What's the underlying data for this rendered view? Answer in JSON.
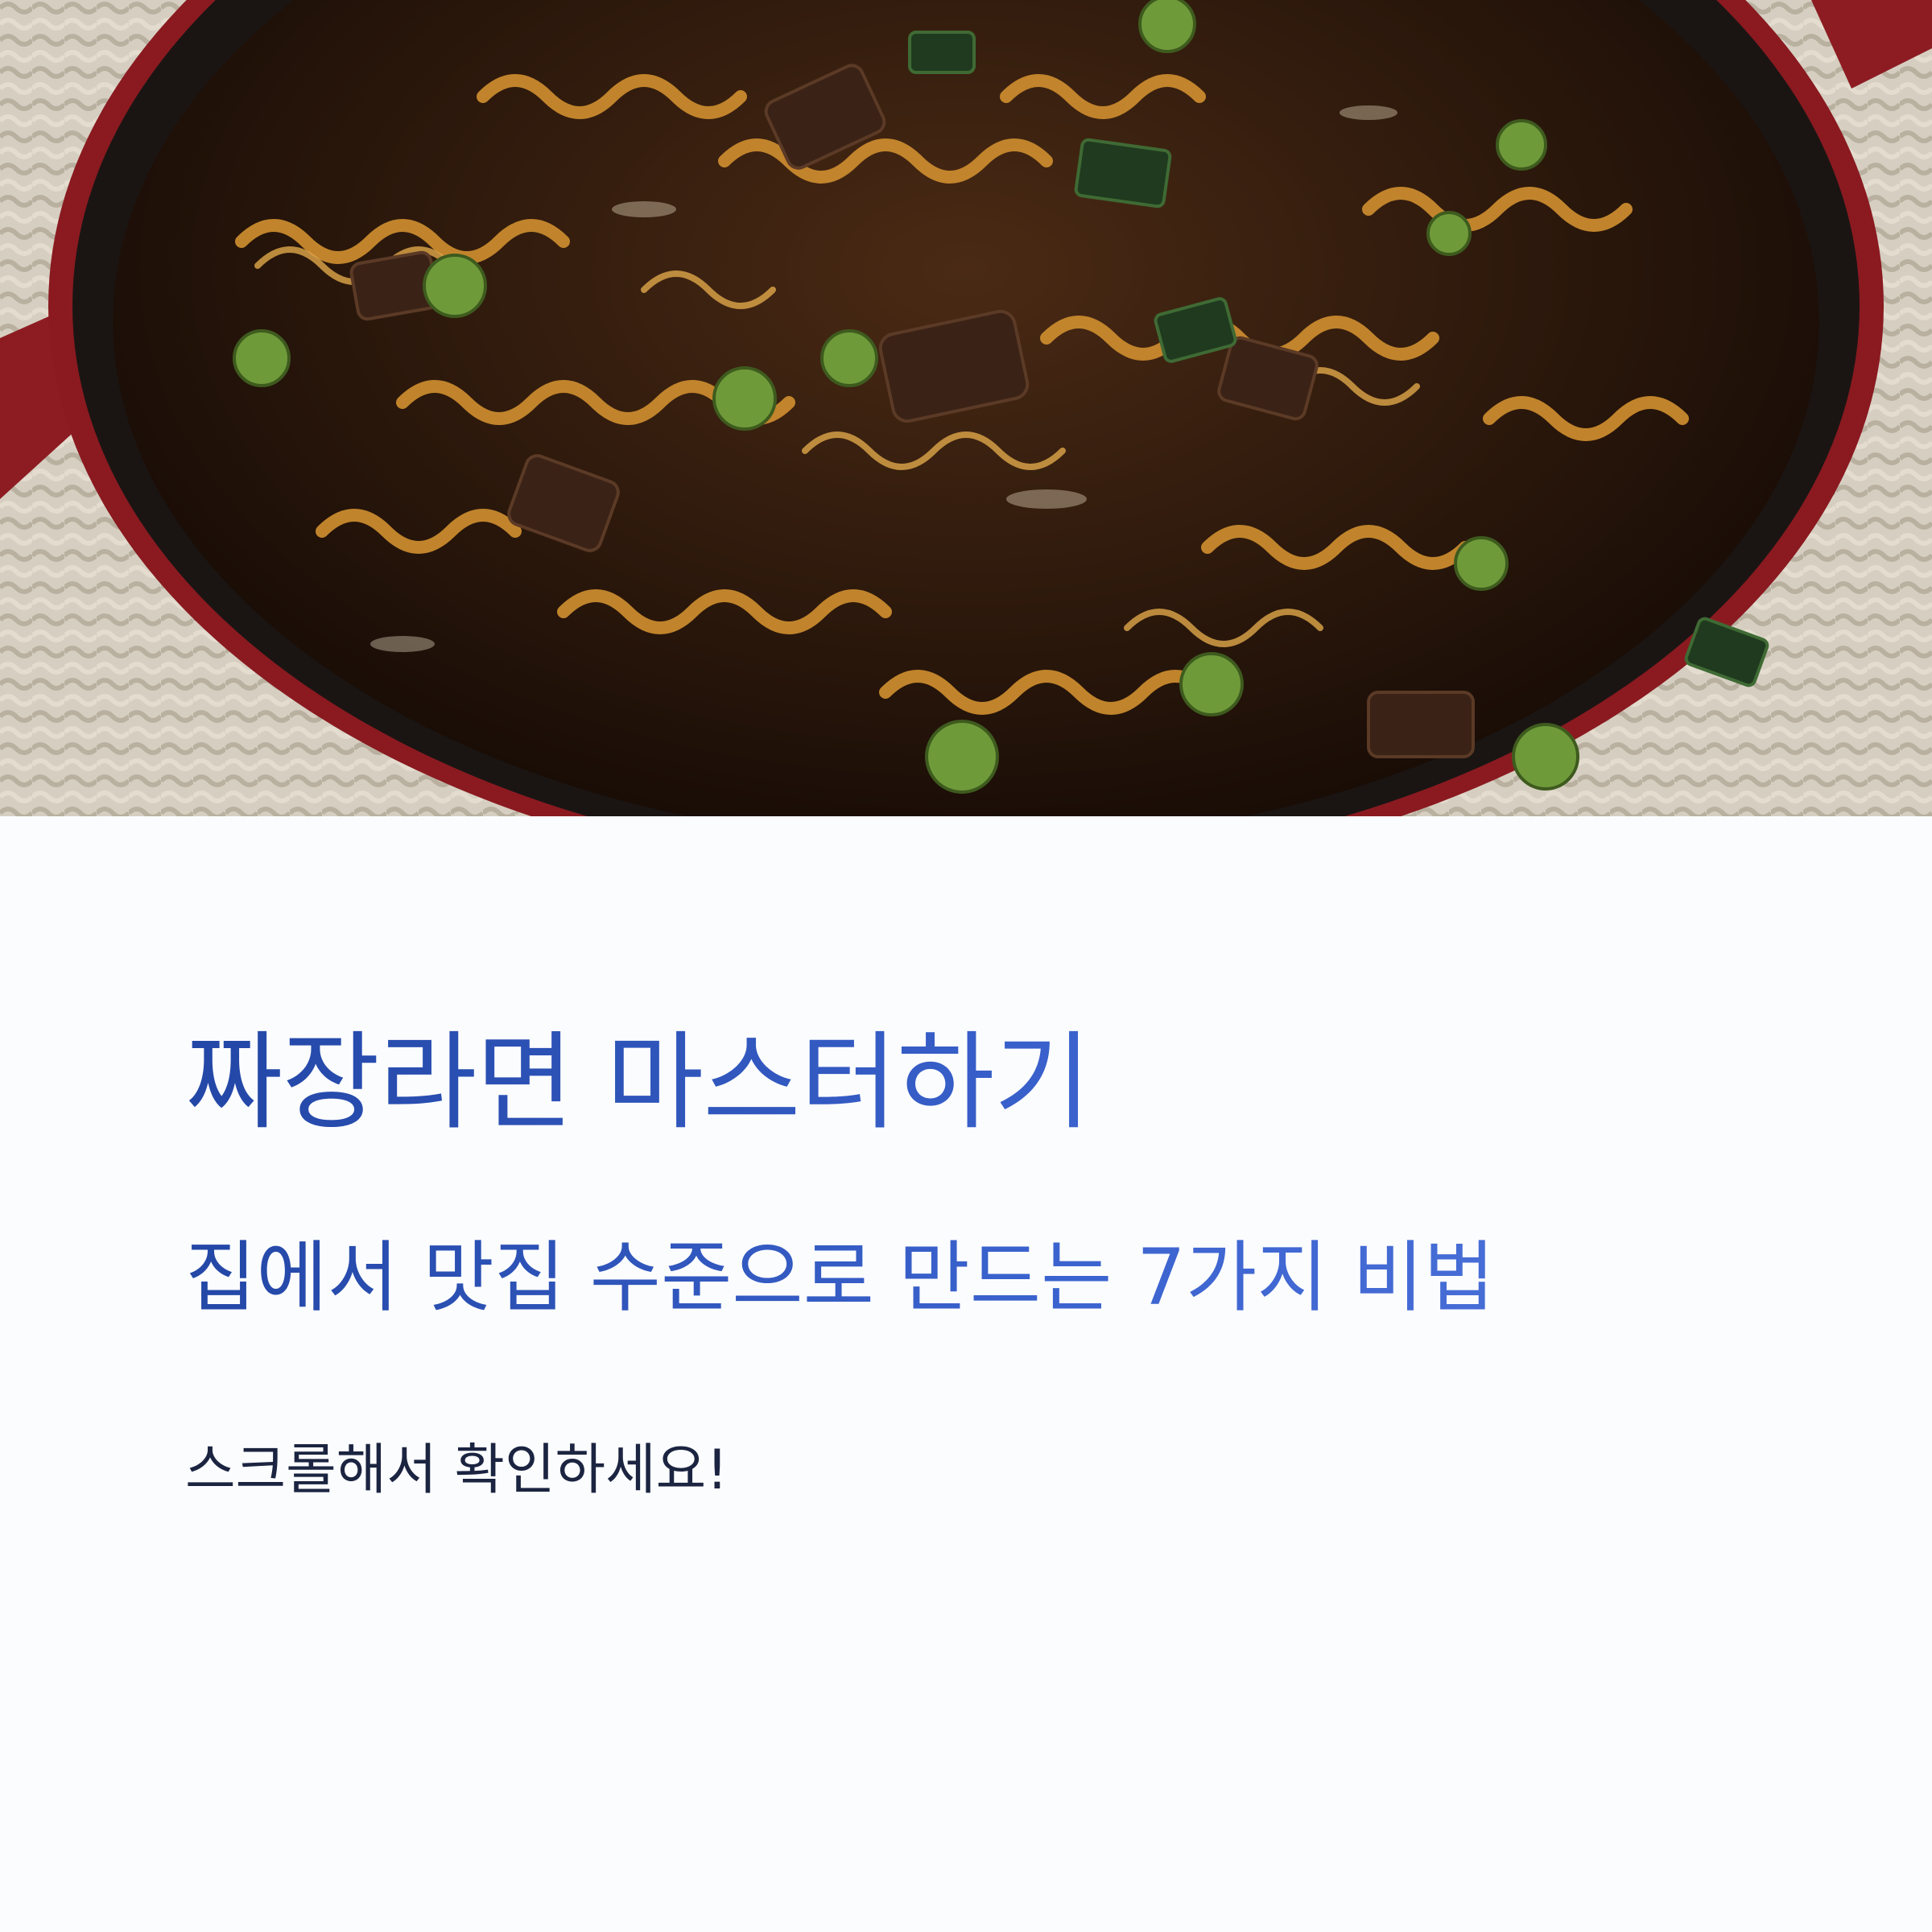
{
  "hero": {
    "photo": "jjajang-ramen-in-red-pot"
  },
  "title": "짜장라면 마스터하기",
  "subtitle": "집에서 맛집 수준으로 만드는 7가지 비법",
  "cta": "스크롤해서 확인하세요!",
  "colors": {
    "accent": "#2f56bf",
    "text_dark": "#1b2440",
    "background": "#fbfcfe"
  }
}
